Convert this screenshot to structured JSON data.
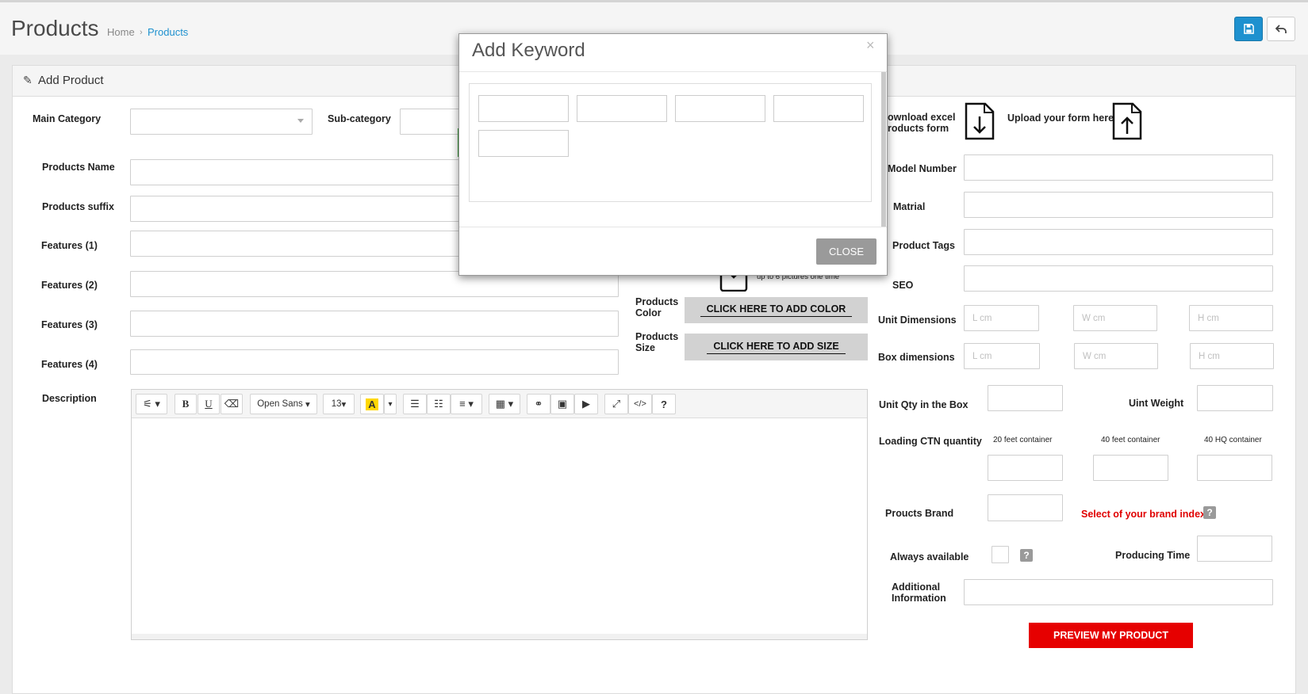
{
  "page": {
    "title": "Products",
    "breadcrumb_home": "Home",
    "breadcrumb_sep": "›",
    "breadcrumb_current": "Products",
    "panel_title": "Add Product"
  },
  "form": {
    "main_category": "Main Category",
    "sub_category": "Sub-category",
    "products_name": "Products Name",
    "products_suffix": "Products suffix",
    "features_1": "Features (1)",
    "features_2": "Features (2)",
    "features_3": "Features (3)",
    "features_4": "Features (4)",
    "description": "Description",
    "upload_hint": "up to 6 pictures one time",
    "products_color": "Products Color",
    "products_size": "Products Size",
    "add_color_btn": "CLICK HERE TO ADD COLOR",
    "add_size_btn": "CLICK HERE TO ADD SIZE",
    "download_excel": "ownload excel roducts form",
    "upload_form": "Upload your form here",
    "model_number": "Model Number",
    "matrial": "Matrial",
    "product_tags": "Product Tags",
    "seo": "SEO",
    "unit_dimensions": "Unit Dimensions",
    "box_dimensions": "Box dimensions",
    "ph_l": "L cm",
    "ph_w": "W cm",
    "ph_h": "H cm",
    "unit_qty": "Unit Qty in the Box",
    "unit_weight": "Uint Weight",
    "loading_ctn": "Loading CTN quantity",
    "c20": "20 feet container",
    "c40": "40 feet container",
    "c40hq": "40 HQ container",
    "brand": "Proucts Brand",
    "brand_index": "Select of your brand index",
    "always_available": "Always available",
    "producing_time": "Producing Time",
    "additional_info": "Additional Information",
    "preview_btn": "PREVIEW MY PRODUCT",
    "help": "?"
  },
  "editor": {
    "font": "Open Sans",
    "size": "13",
    "bold": "B",
    "underline": "U",
    "highlight": "A",
    "code": "</>",
    "help": "?"
  },
  "modal": {
    "title": "Add Keyword",
    "close_x": "×",
    "close_btn": "CLOSE"
  },
  "colors": {
    "primary": "#1e91cf",
    "danger": "#e60000",
    "highlight": "#ffd700"
  }
}
